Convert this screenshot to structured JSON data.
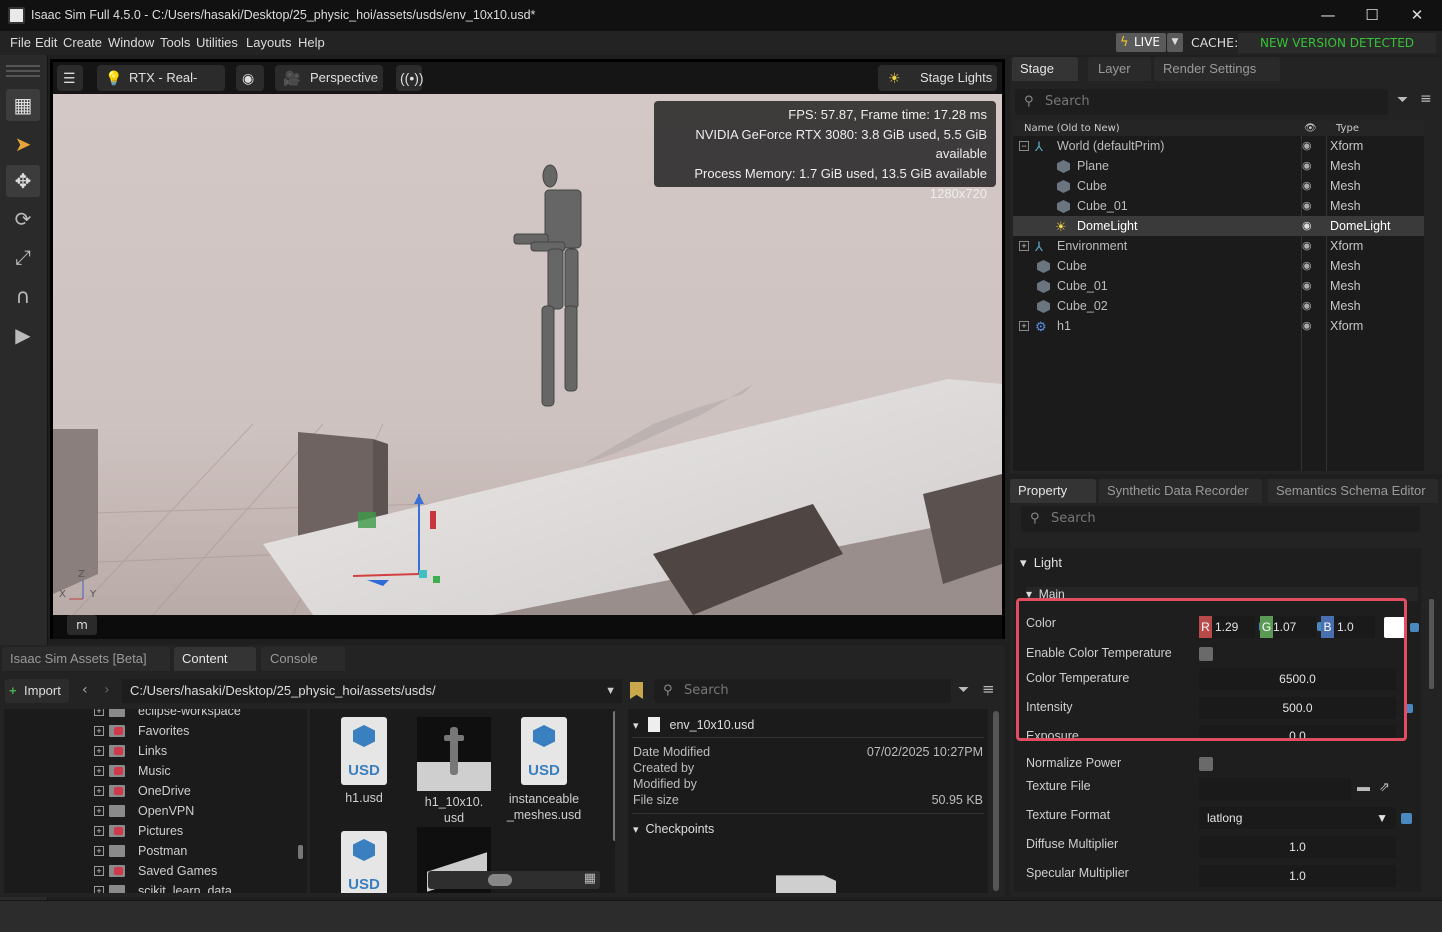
{
  "window": {
    "title": "Isaac Sim Full 4.5.0 - C:/Users/hasaki/Desktop/25_physic_hoi/assets/usds/env_10x10.usd*",
    "minimize": "—",
    "maximize": "☐",
    "close": "✕"
  },
  "menubar": {
    "items": [
      "File",
      "Edit",
      "Create",
      "Window",
      "Tools",
      "Utilities",
      "Layouts",
      "Help"
    ],
    "live_label": "LIVE",
    "cache_label": "CACHE:",
    "cache_status": "NEW VERSION DETECTED"
  },
  "viewport": {
    "renderer": "RTX - Real-Time",
    "camera": "Perspective",
    "lights": "Stage Lights",
    "stats": {
      "fps": "FPS: 57.87, Frame time: 17.28 ms",
      "gpu": "NVIDIA GeForce RTX 3080: 3.8 GiB used, 5.5 GiB available",
      "memory": "Process Memory: 1.7 GiB used, 13.5 GiB available",
      "resolution": "1280x720"
    },
    "mode_chip": "m"
  },
  "stage": {
    "tabs": [
      "Stage",
      "Layer",
      "Render Settings"
    ],
    "search_placeholder": "Search",
    "col_name": "Name (Old to New)",
    "col_type": "Type",
    "rows": [
      {
        "name": "World (defaultPrim)",
        "type": "Xform"
      },
      {
        "name": "Plane",
        "type": "Mesh"
      },
      {
        "name": "Cube",
        "type": "Mesh"
      },
      {
        "name": "Cube_01",
        "type": "Mesh"
      },
      {
        "name": "DomeLight",
        "type": "DomeLight"
      },
      {
        "name": "Environment",
        "type": "Xform"
      },
      {
        "name": "Cube",
        "type": "Mesh"
      },
      {
        "name": "Cube_01",
        "type": "Mesh"
      },
      {
        "name": "Cube_02",
        "type": "Mesh"
      },
      {
        "name": "h1",
        "type": "Xform"
      }
    ]
  },
  "property": {
    "tabs": [
      "Property",
      "Synthetic Data Recorder",
      "Semantics Schema Editor"
    ],
    "search_placeholder": "Search",
    "section": "Light",
    "subsection": "Main",
    "color": {
      "label": "Color",
      "r": "1.29",
      "g": "1.07",
      "b": "1.0",
      "r_tag": "R",
      "g_tag": "G",
      "b_tag": "B"
    },
    "enable_color_temperature": "Enable Color Temperature",
    "color_temperature": {
      "label": "Color Temperature",
      "value": "6500.0"
    },
    "intensity": {
      "label": "Intensity",
      "value": "500.0"
    },
    "exposure": {
      "label": "Exposure",
      "value": "0.0"
    },
    "normalize_power": "Normalize Power",
    "texture_file": "Texture File",
    "texture_format": {
      "label": "Texture Format",
      "value": "latlong"
    },
    "diffuse_multiplier": {
      "label": "Diffuse Multiplier",
      "value": "1.0"
    },
    "specular_multiplier": {
      "label": "Specular Multiplier",
      "value": "1.0"
    }
  },
  "content": {
    "tabs": [
      "Isaac Sim Assets [Beta]",
      "Content",
      "Console"
    ],
    "import_label": "Import",
    "path": "C:/Users/hasaki/Desktop/25_physic_hoi/assets/usds/",
    "search_placeholder": "Search",
    "folders": [
      "eclipse-workspace",
      "Favorites",
      "Links",
      "Music",
      "OneDrive",
      "OpenVPN",
      "Pictures",
      "Postman",
      "Saved Games",
      "scikit_learn_data"
    ],
    "files": [
      {
        "name": "h1.usd"
      },
      {
        "name": "h1_10x10.\nusd"
      },
      {
        "name": "instanceable\n_meshes.usd"
      }
    ],
    "usd_text": "USD",
    "detail": {
      "filename": "env_10x10.usd",
      "date_modified_label": "Date Modified",
      "date_modified": "07/02/2025 10:27PM",
      "created_by_label": "Created by",
      "modified_by_label": "Modified by",
      "file_size_label": "File size",
      "file_size": "50.95 KB",
      "checkpoints": "Checkpoints"
    }
  },
  "colors": {
    "accent_highlight": "#e24d62",
    "cache_status": "#35c435",
    "live_bolt": "#f3c82a"
  }
}
